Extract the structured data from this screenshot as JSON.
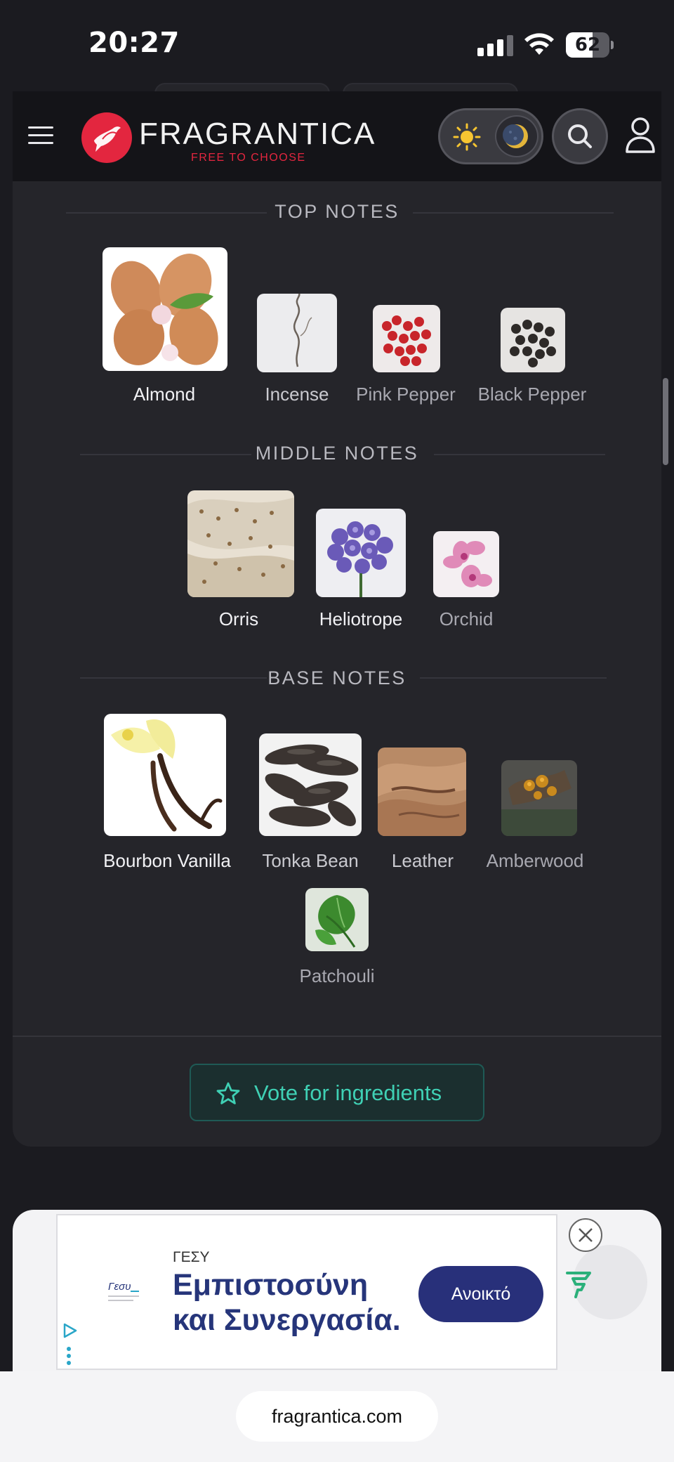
{
  "status": {
    "time": "20:27",
    "battery_percent": "62",
    "battery_level": 0.62
  },
  "header": {
    "logo_text": "FRAGRANTICA",
    "tagline": "FREE TO CHOOSE",
    "theme": "dark"
  },
  "pyramid": {
    "top": {
      "heading": "TOP NOTES",
      "notes": [
        {
          "label": "Almond",
          "icon": "almond"
        },
        {
          "label": "Incense",
          "icon": "incense"
        },
        {
          "label": "Pink Pepper",
          "icon": "pink-pepper"
        },
        {
          "label": "Black Pepper",
          "icon": "black-pepper"
        }
      ]
    },
    "middle": {
      "heading": "MIDDLE NOTES",
      "notes": [
        {
          "label": "Orris",
          "icon": "orris"
        },
        {
          "label": "Heliotrope",
          "icon": "heliotrope"
        },
        {
          "label": "Orchid",
          "icon": "orchid"
        }
      ]
    },
    "base": {
      "heading": "BASE NOTES",
      "notes": [
        {
          "label": "Bourbon Vanilla",
          "icon": "vanilla"
        },
        {
          "label": "Tonka Bean",
          "icon": "tonka-bean"
        },
        {
          "label": "Leather",
          "icon": "leather"
        },
        {
          "label": "Amberwood",
          "icon": "amberwood"
        },
        {
          "label": "Patchouli",
          "icon": "patchouli"
        }
      ]
    }
  },
  "vote_button": {
    "label": "Vote for ingredients",
    "accent": "#3fd0b4"
  },
  "ad": {
    "brand": "ΓΕΣΥ",
    "headline": "Εμπιστοσύνη και Συνεργασία.",
    "cta": "Ανοικτό",
    "logo_text": "Γεσυ"
  },
  "browser": {
    "url": "fragrantica.com"
  },
  "colors": {
    "brand_red": "#e3263f",
    "card_bg": "#25252a",
    "page_bg": "#1b1b20",
    "ad_cta_bg": "#28307a"
  }
}
